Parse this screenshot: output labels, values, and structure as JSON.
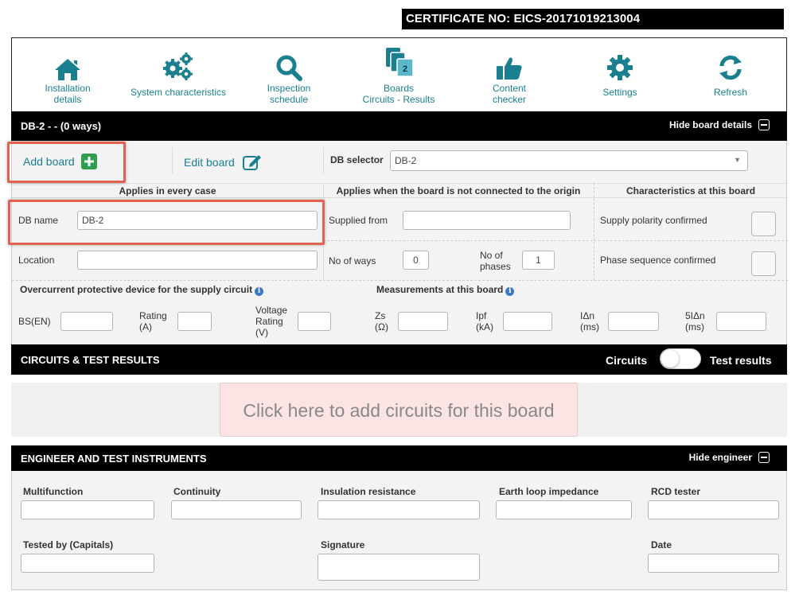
{
  "certificate": "CERTIFICATE NO: EICS-20171019213004",
  "nav": [
    {
      "label1": "Installation",
      "label2": "details",
      "icon": "home-icon"
    },
    {
      "label1": "System characteristics",
      "label2": "",
      "icon": "gears-icon"
    },
    {
      "label1": "Inspection",
      "label2": "schedule",
      "icon": "search-icon"
    },
    {
      "label1": "Boards",
      "label2": "Circuits - Results",
      "icon": "boards-icon",
      "badge": "2"
    },
    {
      "label1": "Content",
      "label2": "checker",
      "icon": "thumbs-up-icon"
    },
    {
      "label1": "Settings",
      "label2": "",
      "icon": "gear-icon"
    },
    {
      "label1": "Refresh",
      "label2": "",
      "icon": "refresh-icon"
    }
  ],
  "board_bar": {
    "title": "DB-2 -  - (0 ways)",
    "toggle": "Hide board details"
  },
  "board_actions": {
    "add": "Add board",
    "edit": "Edit board",
    "selector_label": "DB selector",
    "selector_value": "DB-2"
  },
  "sections": {
    "every_case": "Applies in every case",
    "not_origin": "Applies when the board is not connected to the origin",
    "characteristics": "Characteristics at this board"
  },
  "fields": {
    "db_name_label": "DB name",
    "db_name_value": "DB-2",
    "location_label": "Location",
    "supplied_from_label": "Supplied from",
    "no_of_ways_label": "No of ways",
    "no_of_ways_value": "0",
    "no_of_phases_label1": "No of",
    "no_of_phases_label2": "phases",
    "no_of_phases_value": "1",
    "supply_polarity": "Supply polarity confirmed",
    "phase_sequence": "Phase sequence confirmed"
  },
  "ocpd": {
    "heading": "Overcurrent protective device for the supply circuit",
    "bsen": "BS(EN)",
    "rating1": "Rating",
    "rating2": "(A)",
    "voltage1": "Voltage",
    "voltage2": "Rating",
    "voltage3": "(V)"
  },
  "measurements": {
    "heading": "Measurements at this board",
    "zs1": "Zs",
    "zs2": "(Ω)",
    "ipf1": "Ipf",
    "ipf2": "(kA)",
    "idn1": "IΔn",
    "idn2": "(ms)",
    "idn5_1": "5IΔn",
    "idn5_2": "(ms)"
  },
  "circuits_bar": {
    "title": "CIRCUITS & TEST RESULTS",
    "left_toggle": "Circuits",
    "right_toggle": "Test results"
  },
  "add_circuits": "Click here to add circuits for this board",
  "engineer_bar": {
    "title": "ENGINEER AND TEST INSTRUMENTS",
    "toggle": "Hide engineer"
  },
  "engineer": {
    "multifunction": "Multifunction",
    "continuity": "Continuity",
    "insulation": "Insulation resistance",
    "earth_loop": "Earth loop impedance",
    "rcd": "RCD tester",
    "tested_by": "Tested by (Capitals)",
    "signature": "Signature",
    "date": "Date"
  },
  "colors": {
    "accent": "#1a7f8e",
    "add_green": "#2e9e4f",
    "highlight_red": "#e0624f",
    "add_circuits_bg": "#fce4e4"
  }
}
